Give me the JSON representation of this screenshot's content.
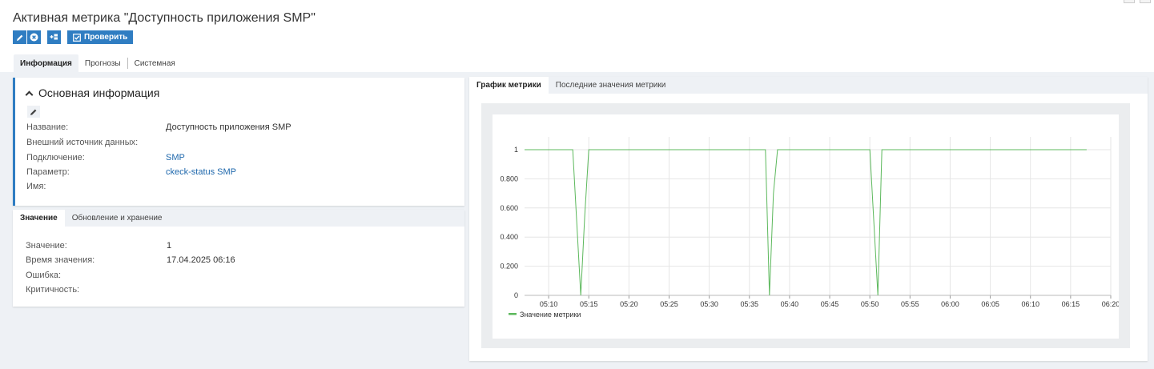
{
  "page": {
    "title": "Активная метрика \"Доступность приложения SMP\""
  },
  "toolbar": {
    "edit_icon": "pencil-icon",
    "delete_icon": "close-circle-icon",
    "add_icon": "add-panel-icon",
    "check_label": "Проверить",
    "check_icon": "checkbox-icon"
  },
  "tabs": [
    "Информация",
    "Прогнозы",
    "Системная"
  ],
  "info": {
    "heading": "Основная информация",
    "rows": [
      {
        "label": "Название:",
        "value": "Доступность приложения SMP"
      },
      {
        "label": "Внешний источник данных:",
        "value": ""
      },
      {
        "label": "Подключение:",
        "value": "SMP"
      },
      {
        "label": "Параметр:",
        "value": "ckeck-status SMP"
      },
      {
        "label": "Имя:",
        "value": ""
      }
    ]
  },
  "value_tabs": [
    "Значение",
    "Обновление и хранение"
  ],
  "value_panel": {
    "rows": [
      {
        "label": "Значение:",
        "value": "1"
      },
      {
        "label": "Время значения:",
        "value": "17.04.2025 06:16"
      },
      {
        "label": "Ошибка:",
        "value": ""
      },
      {
        "label": "Критичность:",
        "value": ""
      }
    ]
  },
  "chart_tabs": [
    "График метрики",
    "Последние значения метрики"
  ],
  "colors": {
    "accent": "#2f7dc2",
    "series": "#5cb85c",
    "link": "#2069ad"
  },
  "chart_data": {
    "type": "line",
    "x_ticks": [
      "05:10",
      "05:15",
      "05:20",
      "05:25",
      "05:30",
      "05:35",
      "05:40",
      "05:45",
      "05:50",
      "05:55",
      "06:00",
      "06:05",
      "06:10",
      "06:15",
      "06:20"
    ],
    "y_ticks": [
      "0",
      "0.200",
      "0.400",
      "0.600",
      "0.800",
      "1"
    ],
    "ylim": [
      0,
      1
    ],
    "xlim": [
      "05:07",
      "06:20"
    ],
    "legend_position": "bottom-left",
    "grid": true,
    "series": [
      {
        "name": "Значение метрики",
        "points": [
          [
            "05:07",
            1
          ],
          [
            "05:11",
            1
          ],
          [
            "05:13",
            1
          ],
          [
            "05:14",
            0
          ],
          [
            "05:14:30",
            0.55
          ],
          [
            "05:15",
            1
          ],
          [
            "05:20",
            1
          ],
          [
            "05:30",
            1
          ],
          [
            "05:36",
            1
          ],
          [
            "05:37",
            1
          ],
          [
            "05:37:30",
            0
          ],
          [
            "05:38",
            0.7
          ],
          [
            "05:38:30",
            1
          ],
          [
            "05:45",
            1
          ],
          [
            "05:50",
            1
          ],
          [
            "05:50:30",
            0.5
          ],
          [
            "05:51",
            0
          ],
          [
            "05:51:30",
            1
          ],
          [
            "06:00",
            1
          ],
          [
            "06:10",
            1
          ],
          [
            "06:17",
            1
          ]
        ]
      }
    ]
  }
}
